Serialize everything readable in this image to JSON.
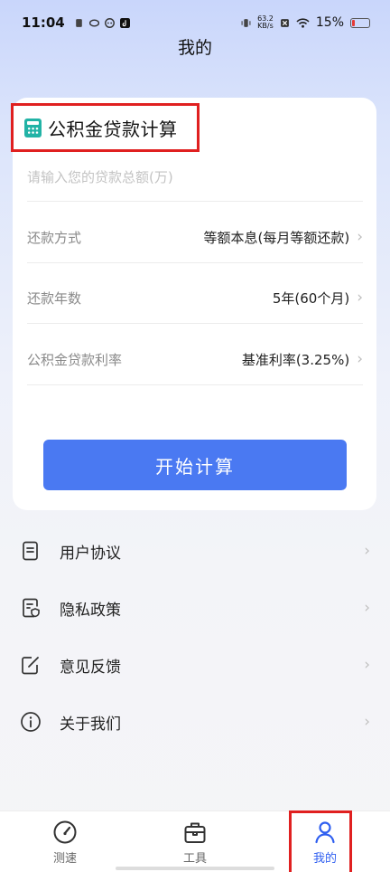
{
  "status_bar": {
    "time": "11:04",
    "net_speed": "63.2",
    "net_unit": "KB/s",
    "battery": "15%",
    "battery_level": 0.15,
    "battery_color": "#e53935"
  },
  "header": {
    "title": "我的"
  },
  "calculator": {
    "title": "公积金贷款计算",
    "amount_placeholder": "请输入您的贷款总额(万)",
    "rows": [
      {
        "label": "还款方式",
        "value": "等额本息(每月等额还款)"
      },
      {
        "label": "还款年数",
        "value": "5年(60个月)"
      },
      {
        "label": "公积金贷款利率",
        "value": "基准利率(3.25%)"
      }
    ],
    "start_button": "开始计算"
  },
  "menu": [
    {
      "label": "用户协议",
      "icon": "document-icon"
    },
    {
      "label": "隐私政策",
      "icon": "privacy-shield-icon"
    },
    {
      "label": "意见反馈",
      "icon": "feedback-edit-icon"
    },
    {
      "label": "关于我们",
      "icon": "info-icon"
    }
  ],
  "tabs": [
    {
      "label": "测速",
      "icon": "speedometer-icon"
    },
    {
      "label": "工具",
      "icon": "toolbox-icon"
    },
    {
      "label": "我的",
      "icon": "person-icon"
    }
  ],
  "colors": {
    "accent": "#4a79f2",
    "tab_active": "#2f5ff0",
    "highlight_box": "#e02020"
  }
}
